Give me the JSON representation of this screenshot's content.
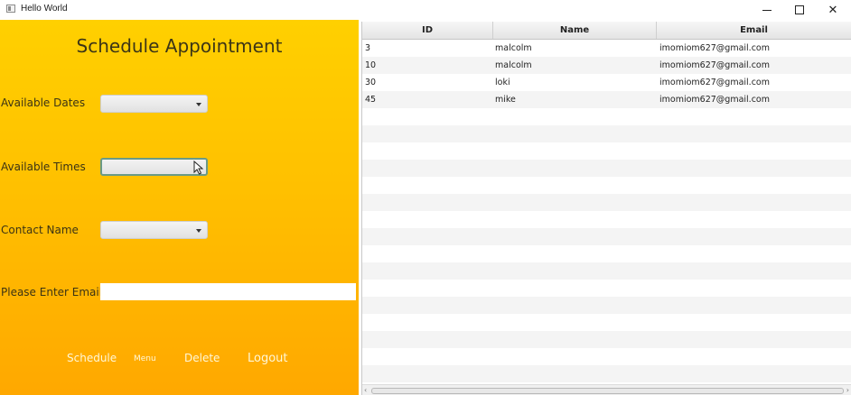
{
  "window": {
    "title": "Hello World"
  },
  "form": {
    "heading": "Schedule Appointment",
    "available_dates_label": "Available Dates",
    "available_times_label": "Available Times",
    "contact_name_label": "Contact Name",
    "email_label": "Please Enter Email",
    "email_value": "",
    "buttons": {
      "schedule": "Schedule",
      "menu": "Menu",
      "delete": "Delete",
      "logout": "Logout"
    }
  },
  "table": {
    "columns": [
      "ID",
      "Name",
      "Email"
    ],
    "rows": [
      {
        "id": "3",
        "name": "malcolm",
        "email": "imomiom627@gmail.com"
      },
      {
        "id": "10",
        "name": "malcolm",
        "email": "imomiom627@gmail.com"
      },
      {
        "id": "30",
        "name": "loki",
        "email": "imomiom627@gmail.com"
      },
      {
        "id": "45",
        "name": "mike",
        "email": "imomiom627@gmail.com"
      }
    ]
  },
  "colors": {
    "panel_top": "#ffd000",
    "panel_bottom": "#ffa800",
    "focus_border": "#6a9a86"
  },
  "icons": {
    "app": "app-window-icon",
    "minimize": "minimize-icon",
    "maximize": "maximize-icon",
    "close": "close-icon",
    "dropdown": "chevron-down-icon",
    "cursor": "mouse-pointer-icon"
  }
}
